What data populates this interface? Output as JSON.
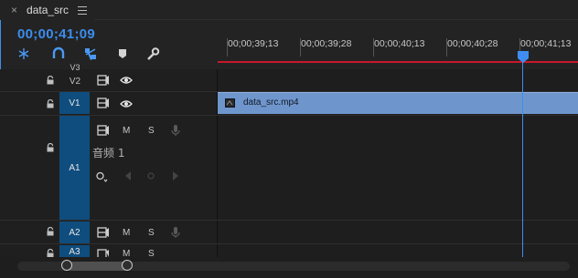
{
  "tab": {
    "close_glyph": "×",
    "title": "data_src"
  },
  "timecode": "00;00;41;09",
  "toolbar": {
    "tools": [
      "snap-icon",
      "magnet-icon",
      "linked-selection-icon",
      "marker-icon",
      "wrench-icon"
    ],
    "accent": "#3b8ded"
  },
  "ruler": {
    "labels": [
      "00;00;39;13",
      "00;00;39;28",
      "00;00;40;13",
      "00;00;40;28",
      "00;00;41;13"
    ]
  },
  "tracks": {
    "v3_label": "V3",
    "v2_label": "V2",
    "v1_label": "V1",
    "a1_label": "A1",
    "a2_label": "A2",
    "a3_label": "A3",
    "mute_label": "M",
    "solo_label": "S"
  },
  "clip": {
    "name": "data_src.mp4",
    "color": "#6f96cc"
  },
  "audio_track_name": "音频 1",
  "colors": {
    "playhead": "#3e8ef1",
    "work_area": "#c8182b",
    "source_patch": "#0f4d7e"
  }
}
